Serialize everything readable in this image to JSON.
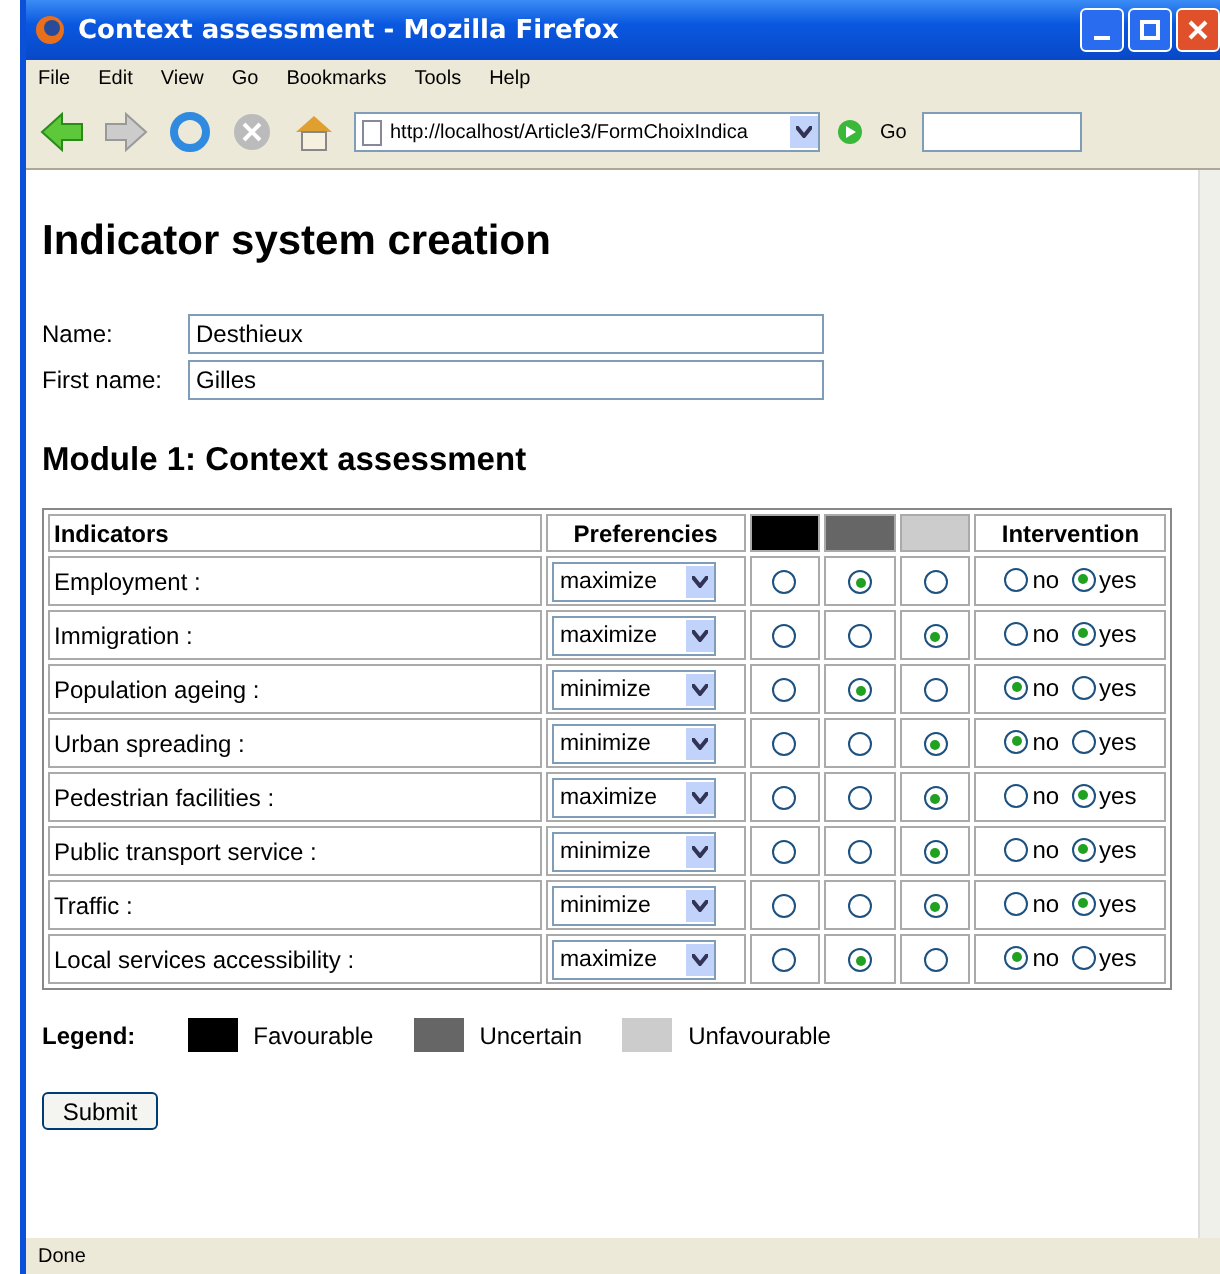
{
  "window": {
    "title": "Context assessment - Mozilla Firefox"
  },
  "menu": [
    "File",
    "Edit",
    "View",
    "Go",
    "Bookmarks",
    "Tools",
    "Help"
  ],
  "address": {
    "value": "http://localhost/Article3/FormChoixIndica",
    "go": "Go"
  },
  "page": {
    "heading": "Indicator system creation",
    "fields": [
      {
        "label": "Name:",
        "value": "Desthieux"
      },
      {
        "label": "First name:",
        "value": "Gilles"
      }
    ],
    "module_heading": "Module 1: Context assessment",
    "table": {
      "columns": [
        {
          "label": "Indicators"
        },
        {
          "label": "Preferencies"
        },
        {
          "color": "#000000"
        },
        {
          "color": "#666666"
        },
        {
          "color": "#cccccc"
        },
        {
          "label": "Intervention"
        }
      ],
      "rows": [
        {
          "indicator": "Employment :",
          "preference": "maximize",
          "ratings": [
            false,
            true,
            false
          ],
          "intervention": [
            {
              "label": "no",
              "selected": false
            },
            {
              "label": "yes",
              "selected": true
            }
          ]
        },
        {
          "indicator": "Immigration :",
          "preference": "maximize",
          "ratings": [
            false,
            false,
            true
          ],
          "intervention": [
            {
              "label": "no",
              "selected": false
            },
            {
              "label": "yes",
              "selected": true
            }
          ]
        },
        {
          "indicator": "Population ageing :",
          "preference": "minimize",
          "ratings": [
            false,
            true,
            false
          ],
          "intervention": [
            {
              "label": "no",
              "selected": true
            },
            {
              "label": "yes",
              "selected": false
            }
          ]
        },
        {
          "indicator": "Urban spreading :",
          "preference": "minimize",
          "ratings": [
            false,
            false,
            true
          ],
          "intervention": [
            {
              "label": "no",
              "selected": true
            },
            {
              "label": "yes",
              "selected": false
            }
          ]
        },
        {
          "indicator": "Pedestrian facilities :",
          "preference": "maximize",
          "ratings": [
            false,
            false,
            true
          ],
          "intervention": [
            {
              "label": "no",
              "selected": false
            },
            {
              "label": "yes",
              "selected": true
            }
          ]
        },
        {
          "indicator": "Public transport service :",
          "preference": "minimize",
          "ratings": [
            false,
            false,
            true
          ],
          "intervention": [
            {
              "label": "no",
              "selected": false
            },
            {
              "label": "yes",
              "selected": true
            }
          ]
        },
        {
          "indicator": "Traffic :",
          "preference": "minimize",
          "ratings": [
            false,
            false,
            true
          ],
          "intervention": [
            {
              "label": "no",
              "selected": false
            },
            {
              "label": "yes",
              "selected": true
            }
          ]
        },
        {
          "indicator": "Local services accessibility :",
          "preference": "maximize",
          "ratings": [
            false,
            true,
            false
          ],
          "intervention": [
            {
              "label": "no",
              "selected": true
            },
            {
              "label": "yes",
              "selected": false
            }
          ]
        }
      ]
    },
    "legend": {
      "label": "Legend:",
      "items": [
        {
          "label": "Favourable",
          "color": "#000000"
        },
        {
          "label": "Uncertain",
          "color": "#666666"
        },
        {
          "label": "Unfavourable",
          "color": "#cccccc"
        }
      ]
    },
    "submit": "Submit"
  },
  "status_bar": "Done"
}
